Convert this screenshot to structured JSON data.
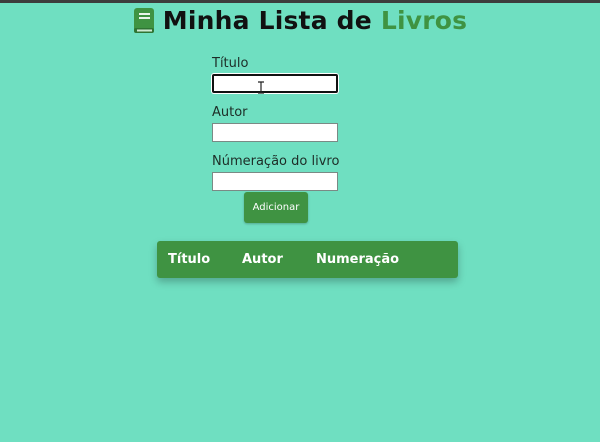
{
  "header": {
    "title_main": "Minha Lista de ",
    "title_accent": "Livros",
    "icon": "book-icon"
  },
  "form": {
    "title_label": "Título",
    "title_value": "",
    "author_label": "Autor",
    "author_value": "",
    "number_label": "Númeração do livro",
    "number_value": "",
    "add_button_label": "Adicionar"
  },
  "table": {
    "headers": [
      "Título",
      "Autor",
      "Numeração"
    ],
    "rows": []
  },
  "colors": {
    "background": "#6fdfc1",
    "accent": "#3f9342"
  }
}
